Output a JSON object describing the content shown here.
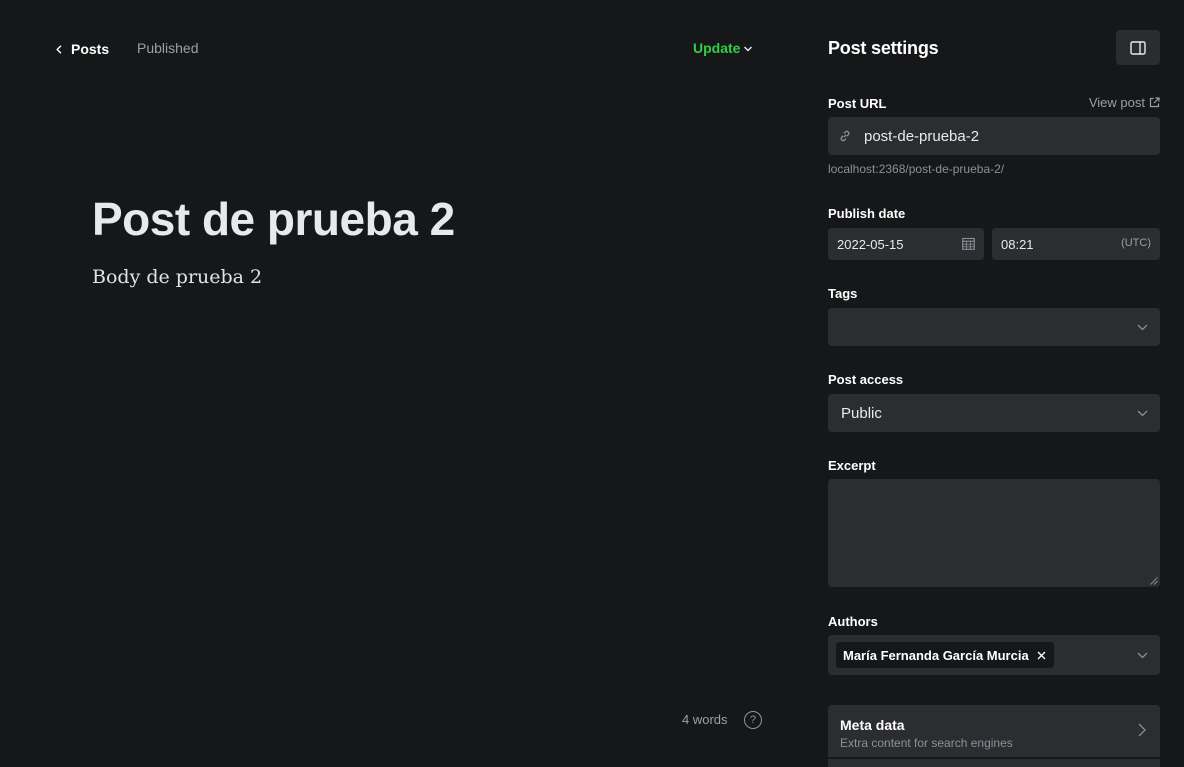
{
  "editor": {
    "back_label": "Posts",
    "status": "Published",
    "update_label": "Update",
    "title": "Post de prueba 2",
    "body": "Body de prueba 2",
    "word_count": "4 words",
    "help_label": "?"
  },
  "settings": {
    "title": "Post settings",
    "post_url": {
      "label": "Post URL",
      "view_post": "View post",
      "slug": "post-de-prueba-2",
      "full_url": "localhost:2368/post-de-prueba-2/"
    },
    "publish_date": {
      "label": "Publish date",
      "date": "2022-05-15",
      "time": "08:21",
      "timezone": "(UTC)"
    },
    "tags": {
      "label": "Tags",
      "value": ""
    },
    "post_access": {
      "label": "Post access",
      "value": "Public"
    },
    "excerpt": {
      "label": "Excerpt",
      "value": ""
    },
    "authors": {
      "label": "Authors",
      "items": [
        "María Fernanda García Murcia"
      ]
    },
    "meta_data": {
      "title": "Meta data",
      "subtitle": "Extra content for search engines"
    }
  },
  "colors": {
    "background": "#151719",
    "field": "#2b2d31",
    "accent_green": "#30cf43",
    "muted_text": "#9aa0a6"
  },
  "icons": [
    "chevron-left-icon",
    "chevron-down-icon",
    "sidebar-toggle-icon",
    "external-link-icon",
    "link-icon",
    "calendar-icon",
    "close-icon",
    "chevron-right-icon",
    "help-icon"
  ]
}
